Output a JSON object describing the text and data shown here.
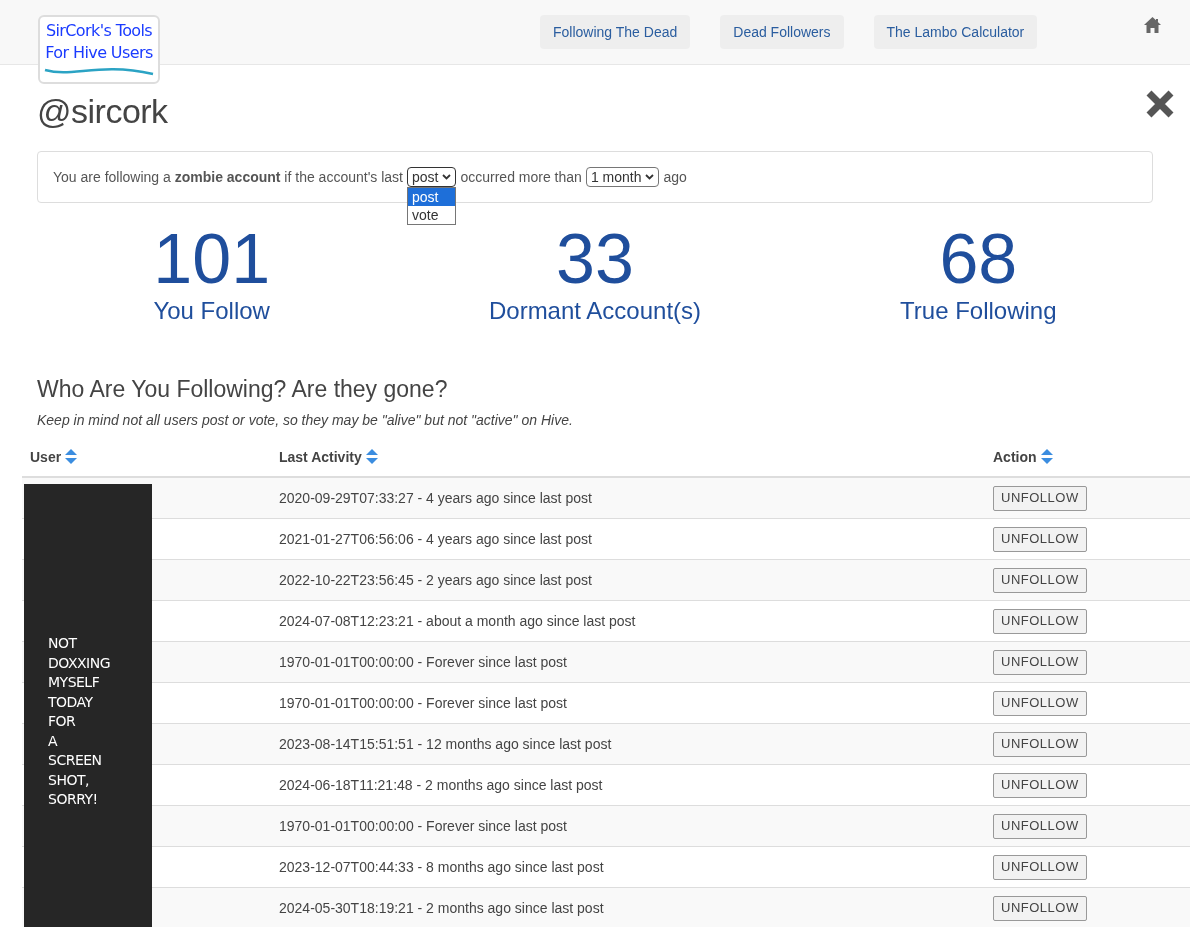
{
  "header": {
    "logo": {
      "lines": [
        "SirCork's Tools",
        "For Hive Users"
      ]
    },
    "nav": [
      {
        "label": "Following The Dead"
      },
      {
        "label": "Dead Followers"
      },
      {
        "label": "The Lambo Calculator"
      }
    ]
  },
  "profile": {
    "handle": "@sircork"
  },
  "filter": {
    "lead": "You are following a **zombie account** if the account's last",
    "activity": {
      "value": "post",
      "expanded": true,
      "options": [
        {
          "label": "post",
          "selected": true
        },
        {
          "label": "vote",
          "selected": false
        }
      ]
    },
    "middle": "occurred more than",
    "period": {
      "value": "1 month",
      "expanded": false
    },
    "tail": "ago"
  },
  "stats": [
    {
      "value": "101",
      "label": "You Follow"
    },
    {
      "value": "33",
      "label": "Dormant Account(s)"
    },
    {
      "value": "68",
      "label": "True Following"
    }
  ],
  "section": {
    "title": "Who Are You Following? Are they gone?",
    "note": "Keep in mind not all users post or vote, so they may be \"alive\" but not \"active\" on Hive."
  },
  "table": {
    "columns": [
      {
        "label": "User"
      },
      {
        "label": "Last Activity"
      },
      {
        "label": "Action"
      }
    ],
    "rows": [
      {
        "last_activity": "2020-09-29T07:33:27 - 4 years ago since last post",
        "action": "UNFOLLOW"
      },
      {
        "last_activity": "2021-01-27T06:56:06 - 4 years ago since last post",
        "action": "UNFOLLOW"
      },
      {
        "last_activity": "2022-10-22T23:56:45 - 2 years ago since last post",
        "action": "UNFOLLOW"
      },
      {
        "last_activity": "2024-07-08T12:23:21 - about a month ago since last post",
        "action": "UNFOLLOW"
      },
      {
        "last_activity": "1970-01-01T00:00:00 - Forever since last post",
        "action": "UNFOLLOW"
      },
      {
        "last_activity": "1970-01-01T00:00:00 - Forever since last post",
        "action": "UNFOLLOW"
      },
      {
        "last_activity": "2023-08-14T15:51:51 - 12 months ago since last post",
        "action": "UNFOLLOW"
      },
      {
        "last_activity": "2024-06-18T11:21:48 - 2 months ago since last post",
        "action": "UNFOLLOW"
      },
      {
        "last_activity": "1970-01-01T00:00:00 - Forever since last post",
        "action": "UNFOLLOW"
      },
      {
        "last_activity": "2023-12-07T00:44:33 - 8 months ago since last post",
        "action": "UNFOLLOW"
      },
      {
        "last_activity": "2024-05-30T18:19:21 - 2 months ago since last post",
        "action": "UNFOLLOW"
      }
    ]
  },
  "redaction": {
    "lines": [
      "NOT",
      "DOXXING",
      "MYSELF",
      "TODAY",
      "FOR",
      "A",
      "SCREEN",
      "SHOT,",
      "SORRY!"
    ]
  }
}
